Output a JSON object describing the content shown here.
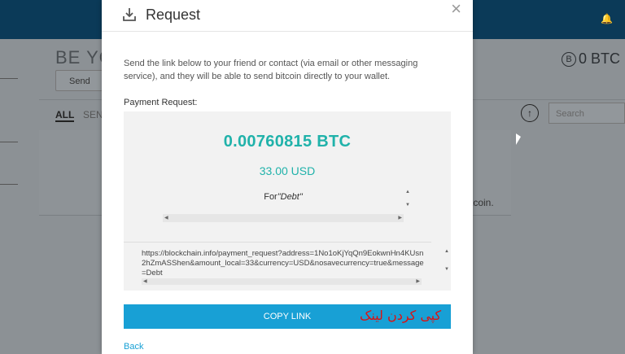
{
  "background": {
    "title_fragment": "BE YO",
    "send_button": "Send",
    "balance": "0 BTC",
    "balance_icon": "bitcoin-icon",
    "filter_all": "ALL",
    "filter_sent": "SEN",
    "search_placeholder": "Search",
    "tx_snippet": "tcoin."
  },
  "modal": {
    "title": "Request",
    "title_icon": "download-icon",
    "close_label": "×",
    "description": "Send the link below to your friend or contact (via email or other messaging service), and they will be able to send bitcoin directly to your wallet.",
    "payment_request_label": "Payment Request:",
    "btc_amount": "0.00760815 BTC",
    "usd_amount": "33.00 USD",
    "note_prefix": "For",
    "note_memo": "\"Debt\"",
    "payment_link": "https://blockchain.info/payment_request?address=1No1oKjYqQn9EokwnHn4KUsn2hZmASShen&amount_local=33&currency=USD&nosavecurrency=true&message=Debt",
    "copy_button": "COPY LINK",
    "annotation": "کپی کردن لینک",
    "back_link": "Back"
  },
  "colors": {
    "accent": "#18a0d5",
    "amount": "#20b2aa",
    "topbar": "#0b3a58",
    "annotation": "#dd1111"
  }
}
